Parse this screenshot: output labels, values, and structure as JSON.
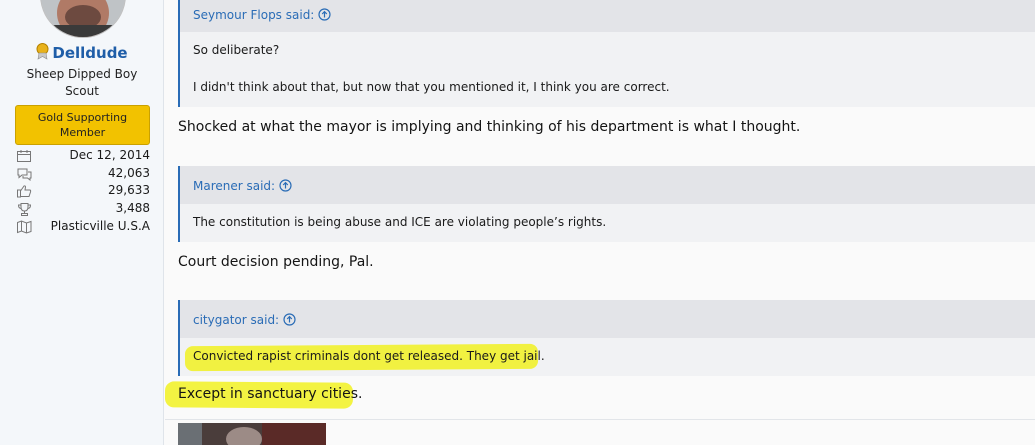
{
  "user": {
    "name": "Delldude",
    "title": "Sheep Dipped Boy Scout",
    "badge": "Gold Supporting Member",
    "stats": [
      {
        "icon": "calendar-icon",
        "value": "Dec 12, 2014"
      },
      {
        "icon": "messages-icon",
        "value": "42,063"
      },
      {
        "icon": "thumbs-up-icon",
        "value": "29,633"
      },
      {
        "icon": "trophy-icon",
        "value": "3,488"
      },
      {
        "icon": "map-icon",
        "value": "Plasticville U.S.A"
      }
    ]
  },
  "quotes": [
    {
      "author": "Seymour Flops said:",
      "lines": [
        "So deliberate?",
        "I didn't think about that, but now that you mentioned it, I think you are correct."
      ]
    },
    {
      "author": "Marener said:",
      "lines": [
        "The constitution is being abuse and ICE are violating people’s rights."
      ]
    },
    {
      "author": "citygator said:",
      "lines": [
        "Convicted rapist criminals dont get released. They get jail."
      ]
    }
  ],
  "replies": [
    "Shocked at what the mayor is implying and thinking of his department is what I thought.",
    "Court decision pending, Pal.",
    "Except in sanctuary cities."
  ],
  "colors": {
    "link": "#2a6cb6",
    "badge": "#f2c200",
    "highlight": "#f1f121"
  }
}
